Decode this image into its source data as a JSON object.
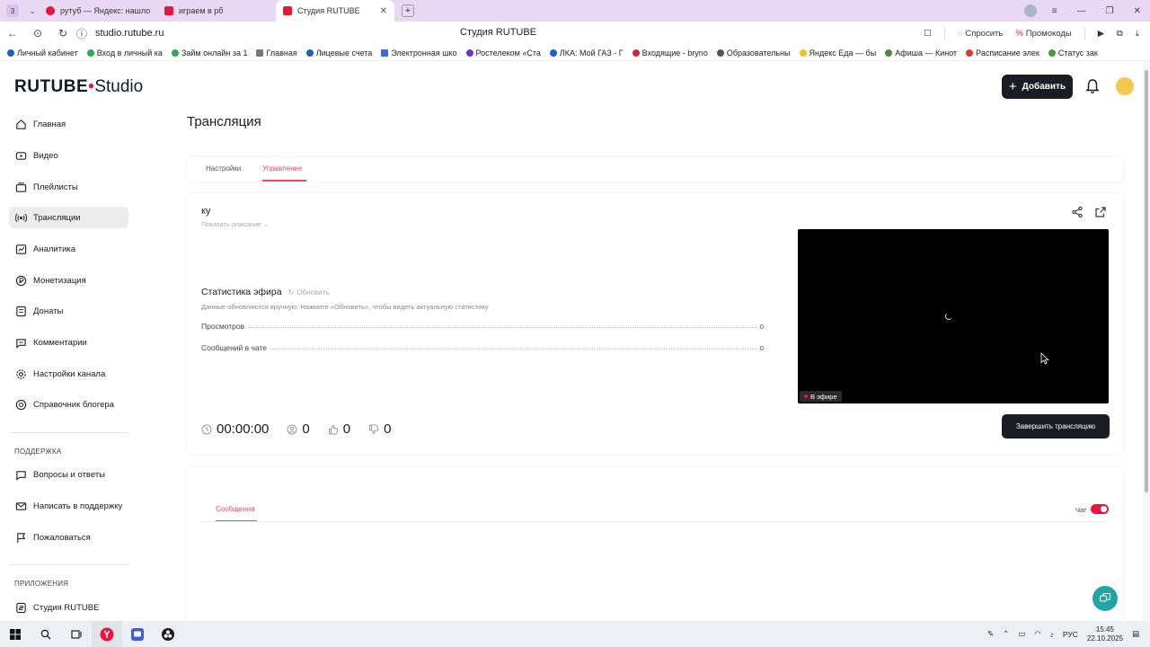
{
  "browser": {
    "tab_count": "3",
    "tabs": [
      {
        "label": "рутуб — Яндекс: нашлось",
        "color": "#ed143b"
      },
      {
        "label": "играем в рб",
        "color": "#ed143b"
      },
      {
        "label": "Студия RUTUBE",
        "color": "#ed143b",
        "active": true
      }
    ],
    "url": "studio.rutube.ru",
    "page_title": "Студия RUTUBE",
    "ask_label": "Спросить",
    "promo_label": "Промокоды",
    "bookmarks": [
      "Личный кабинет",
      "Вход в личный ка",
      "Займ онлайн за 1",
      "Главная",
      "Лицевые счета",
      "Электронная шко",
      "Ростелеком «Ста",
      "ЛКА: Мой ГАЗ - Г",
      "Входящие - bryno",
      "Образовательны",
      "Яндекс Еда — бы",
      "Афиша — Кинот",
      "Расписание элек",
      "Статус зак"
    ]
  },
  "header": {
    "logo_text": "RUTUBE",
    "logo_studio": "Studio",
    "add_label": "Добавить"
  },
  "sidebar": {
    "items": [
      {
        "label": "Главная",
        "icon": "home-icon"
      },
      {
        "label": "Видео",
        "icon": "video-icon"
      },
      {
        "label": "Плейлисты",
        "icon": "playlist-icon"
      },
      {
        "label": "Трансляции",
        "icon": "broadcast-icon",
        "active": true
      },
      {
        "label": "Аналитика",
        "icon": "analytics-icon"
      },
      {
        "label": "Монетизация",
        "icon": "monetization-icon"
      },
      {
        "label": "Донаты",
        "icon": "donate-icon"
      },
      {
        "label": "Комментарии",
        "icon": "comments-icon"
      },
      {
        "label": "Настройки канала",
        "icon": "settings-icon"
      },
      {
        "label": "Справочник блогера",
        "icon": "guide-icon"
      }
    ],
    "support_title": "ПОДДЕРЖКА",
    "support_items": [
      {
        "label": "Вопросы и ответы",
        "icon": "faq-icon"
      },
      {
        "label": "Написать в поддержку",
        "icon": "mail-icon"
      },
      {
        "label": "Пожаловаться",
        "icon": "flag-icon"
      }
    ],
    "apps_title": "ПРИЛОЖЕНИЯ",
    "apps_items": [
      {
        "label": "Студия RUTUBE",
        "icon": "studio-app-icon"
      }
    ]
  },
  "main": {
    "title": "Трансляция",
    "tabs": [
      {
        "label": "Настройки"
      },
      {
        "label": "Управление",
        "active": true
      }
    ],
    "stream": {
      "name": "ку",
      "show_description": "Показать описание",
      "stats_title": "Статистика эфира",
      "refresh_label": "Обновить",
      "stats_note": "Данные обновляются вручную. Нажмите «Обновить», чтобы видеть актуальную статистику",
      "stats": [
        {
          "label": "Просмотров",
          "value": "0"
        },
        {
          "label": "Сообщений в чате",
          "value": "0"
        }
      ],
      "timer": "00:00:00",
      "viewers": "0",
      "likes": "0",
      "dislikes": "0",
      "live_label": "В эфире",
      "end_label": "Завершить трансляцию"
    },
    "chat": {
      "messages_tab": "Сообщения",
      "chat_label": "Чат",
      "chat_enabled": true
    }
  },
  "taskbar": {
    "lang": "РУС",
    "time": "15:45",
    "date": "22.10.2025"
  },
  "colors": {
    "accent": "#ed4b5f",
    "brand_red": "#ed143b",
    "dark_button": "#1b1d24",
    "support_fab": "#22a5a0"
  }
}
